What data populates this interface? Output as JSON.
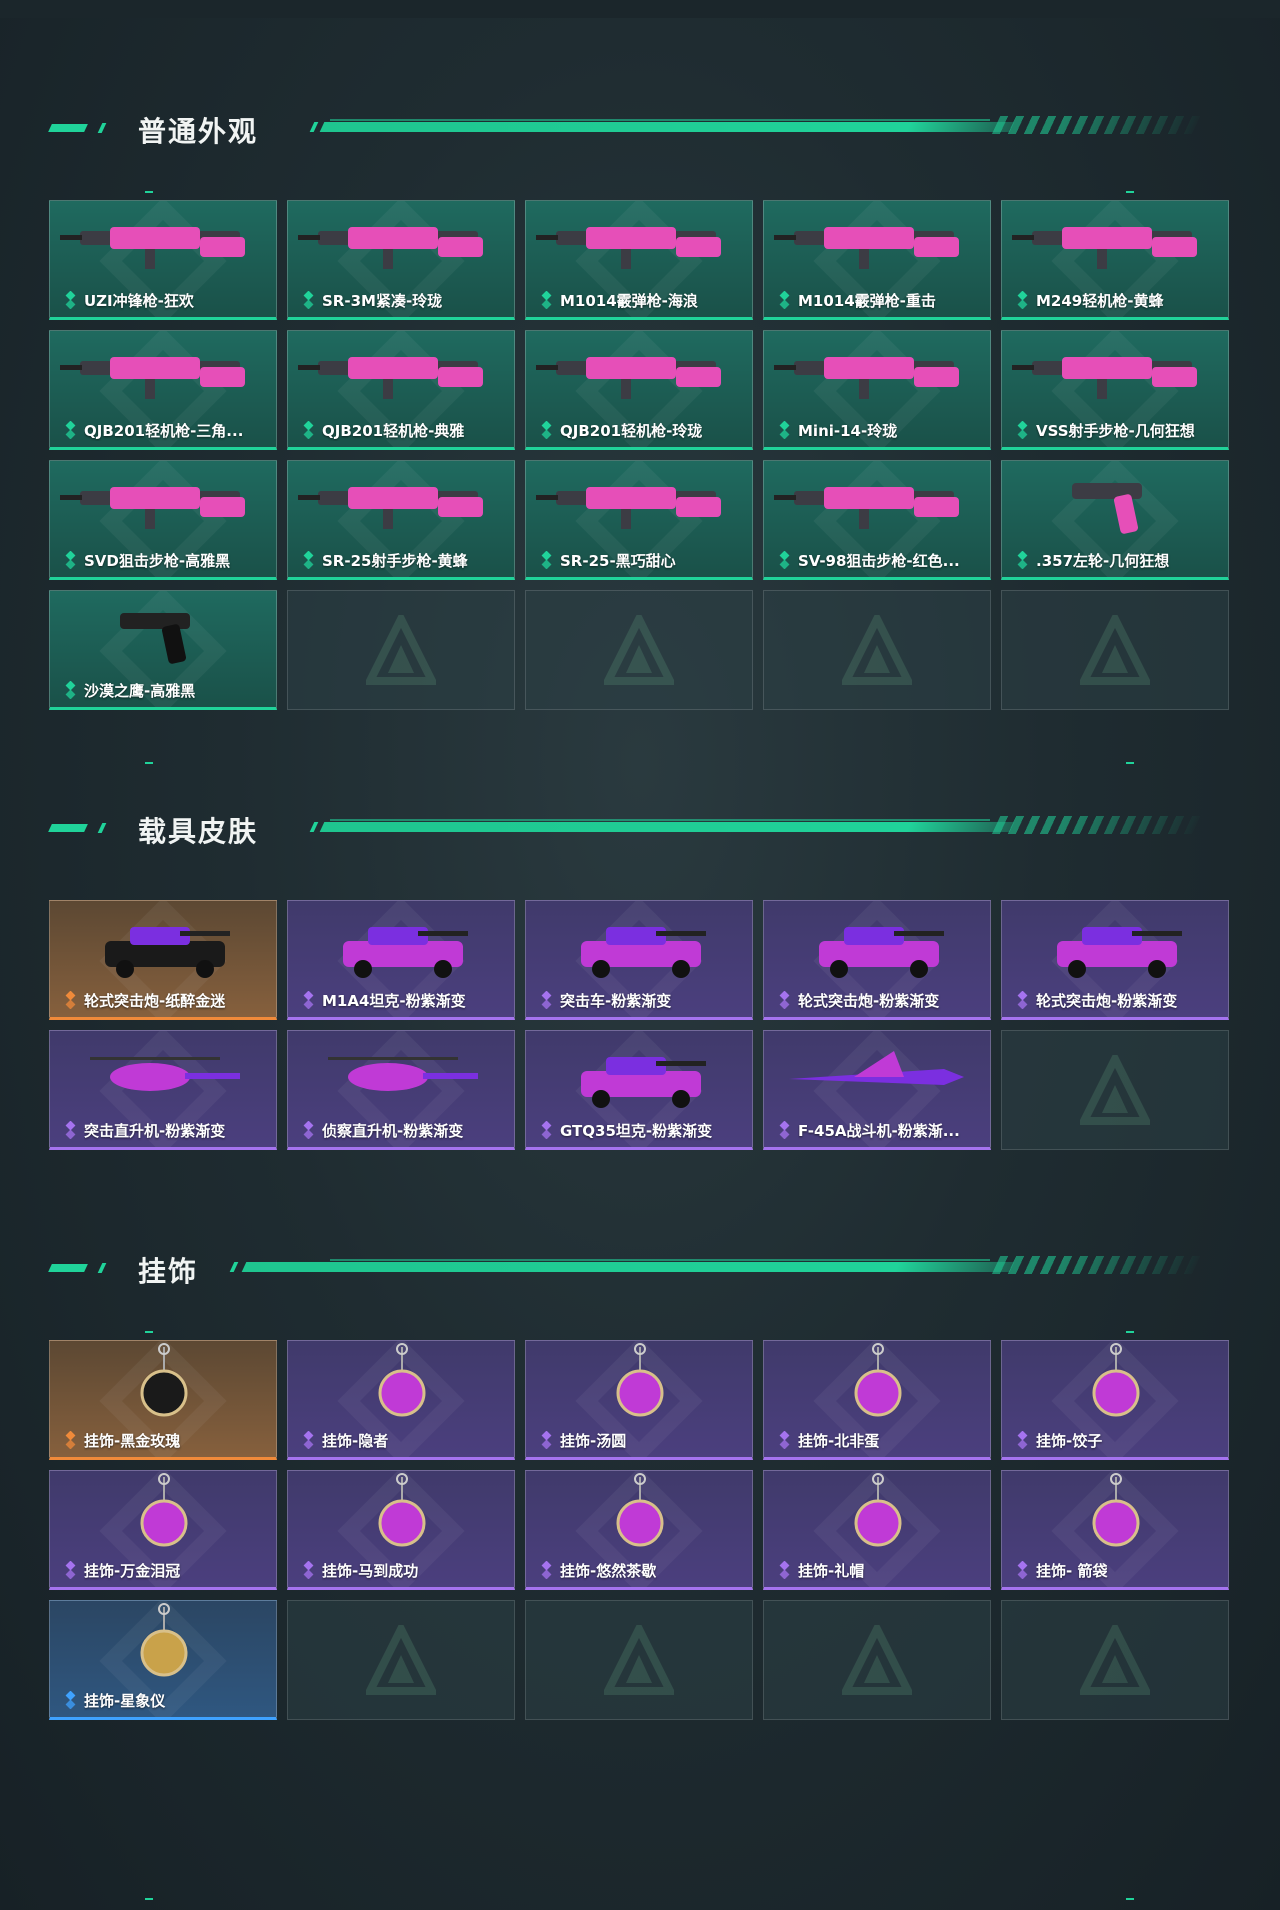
{
  "sections": [
    {
      "title": "普通外观",
      "theme_color": "#20d39a",
      "items": [
        {
          "label": "UZI冲锋枪-狂欢",
          "rarity": "green",
          "icon": "smg-icon"
        },
        {
          "label": "SR-3M紧凑-玲珑",
          "rarity": "green",
          "icon": "rifle-icon"
        },
        {
          "label": "M1014霰弹枪-海浪",
          "rarity": "green",
          "icon": "shotgun-icon"
        },
        {
          "label": "M1014霰弹枪-重击",
          "rarity": "green",
          "icon": "shotgun-icon"
        },
        {
          "label": "M249轻机枪-黄蜂",
          "rarity": "green",
          "icon": "lmg-icon"
        },
        {
          "label": "QJB201轻机枪-三角...",
          "rarity": "green",
          "icon": "lmg-icon"
        },
        {
          "label": "QJB201轻机枪-典雅",
          "rarity": "green",
          "icon": "lmg-icon"
        },
        {
          "label": "QJB201轻机枪-玲珑",
          "rarity": "green",
          "icon": "lmg-icon"
        },
        {
          "label": "Mini-14-玲珑",
          "rarity": "green",
          "icon": "rifle-icon"
        },
        {
          "label": "VSS射手步枪-几何狂想",
          "rarity": "green",
          "icon": "rifle-icon"
        },
        {
          "label": "SVD狙击步枪-高雅黑",
          "rarity": "green",
          "icon": "sniper-icon"
        },
        {
          "label": "SR-25射手步枪-黄蜂",
          "rarity": "green",
          "icon": "rifle-icon"
        },
        {
          "label": "SR-25-黑巧甜心",
          "rarity": "green",
          "icon": "rifle-icon"
        },
        {
          "label": "SV-98狙击步枪-红色...",
          "rarity": "green",
          "icon": "sniper-icon"
        },
        {
          "label": ".357左轮-几何狂想",
          "rarity": "green",
          "icon": "revolver-icon"
        },
        {
          "label": "沙漠之鹰-高雅黑",
          "rarity": "green",
          "icon": "pistol-icon"
        }
      ],
      "empty_slots": 4
    },
    {
      "title": "载具皮肤",
      "theme_color": "#a573ef",
      "items": [
        {
          "label": "轮式突击炮-纸醉金迷",
          "rarity": "orange",
          "icon": "armored-car-icon"
        },
        {
          "label": "M1A4坦克-粉紫渐变",
          "rarity": "purple",
          "icon": "tank-icon"
        },
        {
          "label": "突击车-粉紫渐变",
          "rarity": "purple",
          "icon": "assault-vehicle-icon"
        },
        {
          "label": "轮式突击炮-粉紫渐变",
          "rarity": "purple",
          "icon": "armored-car-icon"
        },
        {
          "label": "轮式突击炮-粉紫渐变",
          "rarity": "purple",
          "icon": "armored-car-icon"
        },
        {
          "label": "突击直升机-粉紫渐变",
          "rarity": "purple",
          "icon": "helicopter-icon"
        },
        {
          "label": "侦察直升机-粉紫渐变",
          "rarity": "purple",
          "icon": "helicopter-icon"
        },
        {
          "label": "GTQ35坦克-粉紫渐变",
          "rarity": "purple",
          "icon": "tank-icon"
        },
        {
          "label": "F-45A战斗机-粉紫渐...",
          "rarity": "purple",
          "icon": "jet-icon"
        }
      ],
      "empty_slots": 1
    },
    {
      "title": "挂饰",
      "theme_color": "#a573ef",
      "items": [
        {
          "label": "挂饰-黑金玫瑰",
          "rarity": "orange",
          "icon": "charm-icon"
        },
        {
          "label": "挂饰-隐者",
          "rarity": "purple",
          "icon": "charm-icon"
        },
        {
          "label": "挂饰-汤圆",
          "rarity": "purple",
          "icon": "charm-icon"
        },
        {
          "label": "挂饰-北非蛋",
          "rarity": "purple",
          "icon": "charm-icon"
        },
        {
          "label": "挂饰-饺子",
          "rarity": "purple",
          "icon": "charm-icon"
        },
        {
          "label": "挂饰-万金泪冠",
          "rarity": "purple",
          "icon": "charm-icon"
        },
        {
          "label": "挂饰-马到成功",
          "rarity": "purple",
          "icon": "charm-icon"
        },
        {
          "label": "挂饰-悠然茶歇",
          "rarity": "purple",
          "icon": "charm-icon"
        },
        {
          "label": "挂饰-礼帽",
          "rarity": "purple",
          "icon": "charm-icon"
        },
        {
          "label": "挂饰- 箭袋",
          "rarity": "purple",
          "icon": "charm-icon"
        },
        {
          "label": "挂饰-星象仪",
          "rarity": "blue",
          "icon": "charm-icon"
        }
      ],
      "empty_slots": 4
    }
  ],
  "colors": {
    "green": "#20d39a",
    "purple": "#a573ef",
    "orange": "#f08a3a",
    "blue": "#3fa2ff"
  }
}
